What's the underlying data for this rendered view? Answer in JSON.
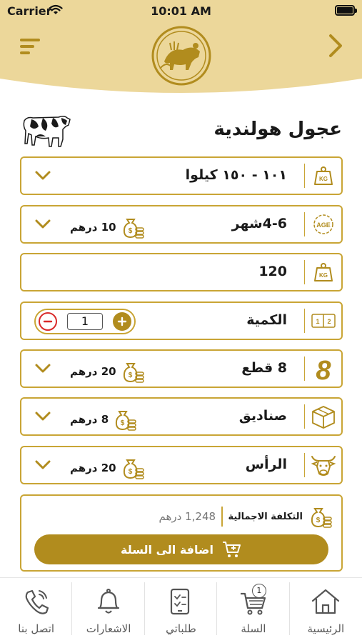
{
  "status_bar": {
    "carrier": "Carrier",
    "time": "10:01 AM"
  },
  "colors": {
    "gold": "#b18c1e",
    "gold_light": "#ecd79a",
    "border": "#c9a535",
    "minus_red": "#d92a2a"
  },
  "header": {
    "menu_icon": "menu-icon",
    "back_icon": "chevron-right-icon",
    "logo_icon": "farm-logo"
  },
  "product": {
    "title": "عجول هولندية"
  },
  "options": [
    {
      "id": "weight",
      "label": "١٠١ - ١٥٠ كيلوا",
      "icon": "kg-weight-icon",
      "price": null
    },
    {
      "id": "age",
      "label": "4-6شهر",
      "icon": "age-icon",
      "price": "10 درهم"
    },
    {
      "id": "custom_weight",
      "label": "120",
      "icon": "kg-weight-icon",
      "price": null
    },
    {
      "id": "quantity",
      "label": "الكمية",
      "icon": "quantity-icon",
      "quantity": "1"
    },
    {
      "id": "pieces",
      "label": "8 قطع",
      "icon": "eight-pieces-icon",
      "price": "20 درهم"
    },
    {
      "id": "packaging",
      "label": "صناديق",
      "icon": "box-icon",
      "price": "8 درهم"
    },
    {
      "id": "head",
      "label": "الرأس",
      "icon": "cow-head-icon",
      "price": "20 درهم"
    }
  ],
  "summary": {
    "total_label": "التكلفة الاجمالية",
    "total_value": "1,248 درهم",
    "add_to_cart": "اضافة الى السلة"
  },
  "tabbar": {
    "items": [
      {
        "label": "الرئيسية",
        "icon": "home-icon"
      },
      {
        "label": "السلة",
        "icon": "cart-icon",
        "badge": "1"
      },
      {
        "label": "طلباتي",
        "icon": "orders-icon"
      },
      {
        "label": "الاشعارات",
        "icon": "bell-icon"
      },
      {
        "label": "اتصل بنا",
        "icon": "phone-icon"
      }
    ]
  }
}
